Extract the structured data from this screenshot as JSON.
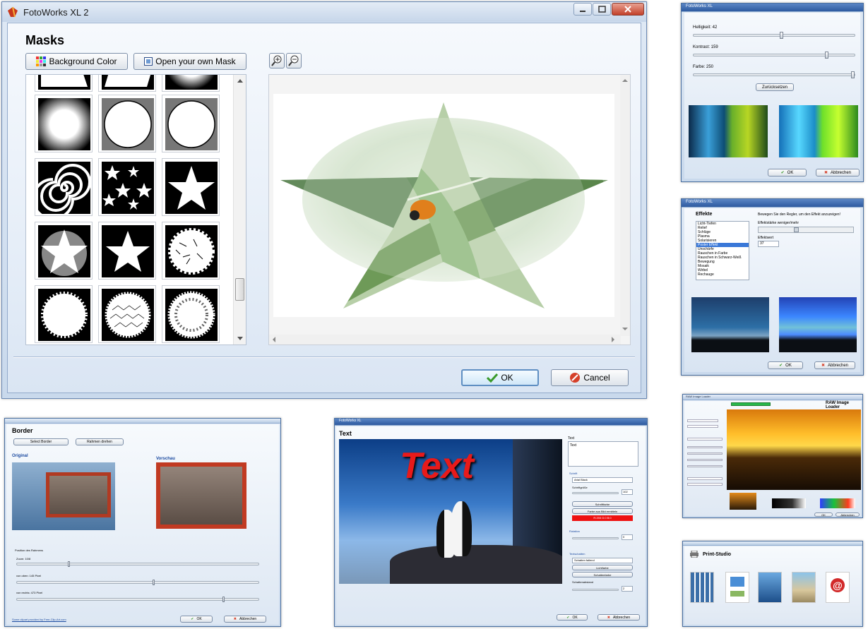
{
  "main": {
    "title": "FotoWorks XL 2",
    "heading": "Masks",
    "bg_color_label": "Background Color",
    "open_mask_label": "Open your own Mask",
    "ok_label": "OK",
    "cancel_label": "Cancel",
    "icons": [
      "app-icon",
      "palette-icon",
      "mask-icon",
      "zoom-in-icon",
      "zoom-out-icon",
      "checkmark-icon",
      "cancel-icon",
      "minimize-icon",
      "maximize-icon",
      "close-icon"
    ]
  },
  "adjust": {
    "title": "FotoWorks XL",
    "brightness_label": "Helligkeit: 42",
    "contrast_label": "Kontrast: 159",
    "color_label": "Farbe: 250",
    "sliders": [
      0.55,
      0.83,
      0.99
    ],
    "reset_label": "Zurücksetzen",
    "ok_label": "OK",
    "cancel_label": "Abbrechen"
  },
  "effects": {
    "title": "FotoWorks XL",
    "heading": "Effekte",
    "hint": "Bewegen Sie den Regler, um den Effekt anzuzeigen!",
    "strength_label": "Effektstärke weniger/mehr",
    "value_label": "Effektwert",
    "value": "37",
    "slider_level": 0.37,
    "items": [
      "Licht-Tiefen",
      "Relief",
      "Schlüge",
      "Plasma",
      "Solarisieren",
      "Poster Effekt",
      "Unschärfe",
      "Rauschen in Farbe",
      "Rauschen in Schwarz-Weiß",
      "Bewegung",
      "Mosaik",
      "Wirbel",
      "Rechauge"
    ],
    "selected_index": 5,
    "ok_label": "OK",
    "cancel_label": "Abbrechen"
  },
  "border": {
    "heading": "Border",
    "select_label": "Select Border",
    "rotate_label": "Rahmen drehen",
    "original_label": "Original",
    "preview_label": "Vorschau",
    "position_label": "Position des Rahmens",
    "zoom_label": "Zoom: 10/8",
    "top_label": "von oben: 145 Pixel",
    "right_label": "von rechts: 473 Pixel",
    "sliders": [
      0.22,
      0.57,
      0.86
    ],
    "credit": "Some clipart provided by Free-Clip-Art.com",
    "ok_label": "OK",
    "cancel_label": "Abbrechen"
  },
  "text": {
    "title": "FotoWorks XL",
    "heading": "Text",
    "text_label": "Text",
    "text_value": "Text",
    "overlay_text": "Text",
    "font_label": "Schrift",
    "font_value": "Arial Black",
    "size_label": "Schriftgröße",
    "size_value": "102",
    "font_color_btn": "Schriftfarbe",
    "pick_color_btn": "Farbe aus Bild ermitteln",
    "rgb_value": "R:255 G:0 B:0",
    "rotation_label": "Rotation",
    "rotation_value": "0",
    "shadow_label": "Textschatten",
    "shadow_value": "Schatten fallend",
    "light_btn": "Lichtfarbe",
    "shadow_btn": "Schattenfarbe",
    "distance_label": "Schattenabstand",
    "distance_value": "2",
    "ok_label": "OK",
    "cancel_label": "Abbrechen"
  },
  "raw": {
    "title": "RAW Image Loader",
    "heading": "RAW Image Loader",
    "ok_label": "OK",
    "cancel_label": "Abbrechen"
  },
  "print": {
    "heading": "Print-Studio"
  }
}
